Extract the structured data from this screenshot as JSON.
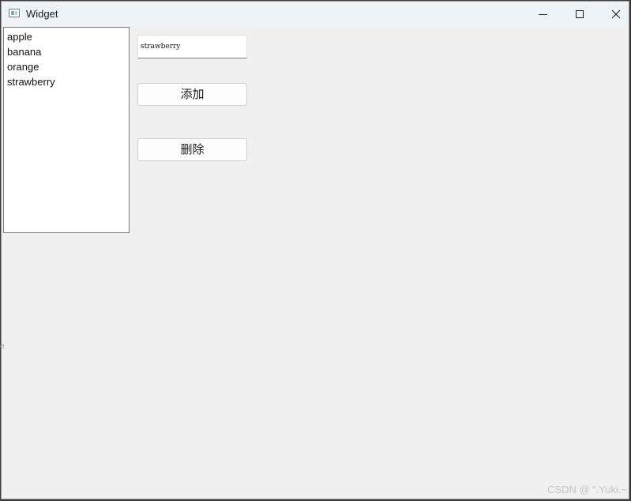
{
  "window": {
    "title": "Widget",
    "controls": {
      "minimize": "minimize-icon",
      "maximize": "maximize-icon",
      "close": "close-icon"
    }
  },
  "list": {
    "items": [
      "apple",
      "banana",
      "orange",
      "strawberry"
    ]
  },
  "input": {
    "value": "strawberry"
  },
  "buttons": {
    "add_label": "添加",
    "delete_label": "删除"
  },
  "side_glyph": "e",
  "watermark": "CSDN @ “.Yuki.~"
}
